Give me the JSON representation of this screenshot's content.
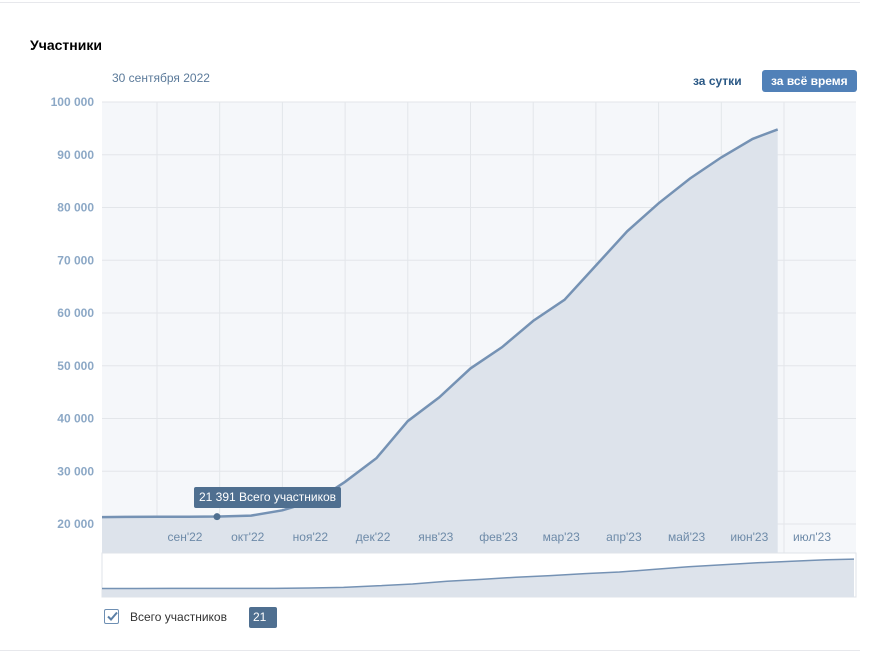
{
  "header": {
    "title": "Участники",
    "date": "30 сентября 2022"
  },
  "period_buttons": {
    "day": "за сутки",
    "all_time": "за всё время"
  },
  "tooltip": {
    "value": "21 391",
    "label": "Всего участников"
  },
  "legend": {
    "label": "Всего участников",
    "value": "21 391",
    "checked": true
  },
  "colors": {
    "line": "#7592b4",
    "fill": "#dde3eb",
    "accent": "#5181b8",
    "tooltip": "#4f6f90"
  },
  "chart_data": {
    "type": "area",
    "y_ticks": [
      "100 000",
      "90 000",
      "80 000",
      "70 000",
      "60 000",
      "50 000",
      "40 000",
      "30 000",
      "20 000"
    ],
    "ylim": [
      20000,
      100000
    ],
    "x_ticks": [
      "сен'22",
      "окт'22",
      "ноя'22",
      "дек'22",
      "янв'23",
      "фев'23",
      "мар'23",
      "апр'23",
      "май'23",
      "июн'23",
      "июл'23"
    ],
    "series": [
      {
        "name": "Всего участников",
        "x": [
          0,
          0.5,
          1.0,
          1.5,
          2.0,
          2.5,
          3.0,
          3.2,
          3.5,
          4.0,
          4.5,
          5.0,
          5.5,
          6.0,
          6.5,
          7.0,
          7.5,
          8.0,
          8.5,
          9.0,
          9.5,
          10.0,
          10.5,
          10.9
        ],
        "values": [
          21300,
          21350,
          21380,
          21391,
          21420,
          21600,
          22600,
          23300,
          24100,
          28000,
          32500,
          39500,
          44000,
          49500,
          53500,
          58500,
          62500,
          69000,
          75500,
          80800,
          85500,
          89500,
          93000,
          94800
        ]
      }
    ],
    "highlight": {
      "x": 1.0,
      "value": 21391
    },
    "grid": true
  }
}
